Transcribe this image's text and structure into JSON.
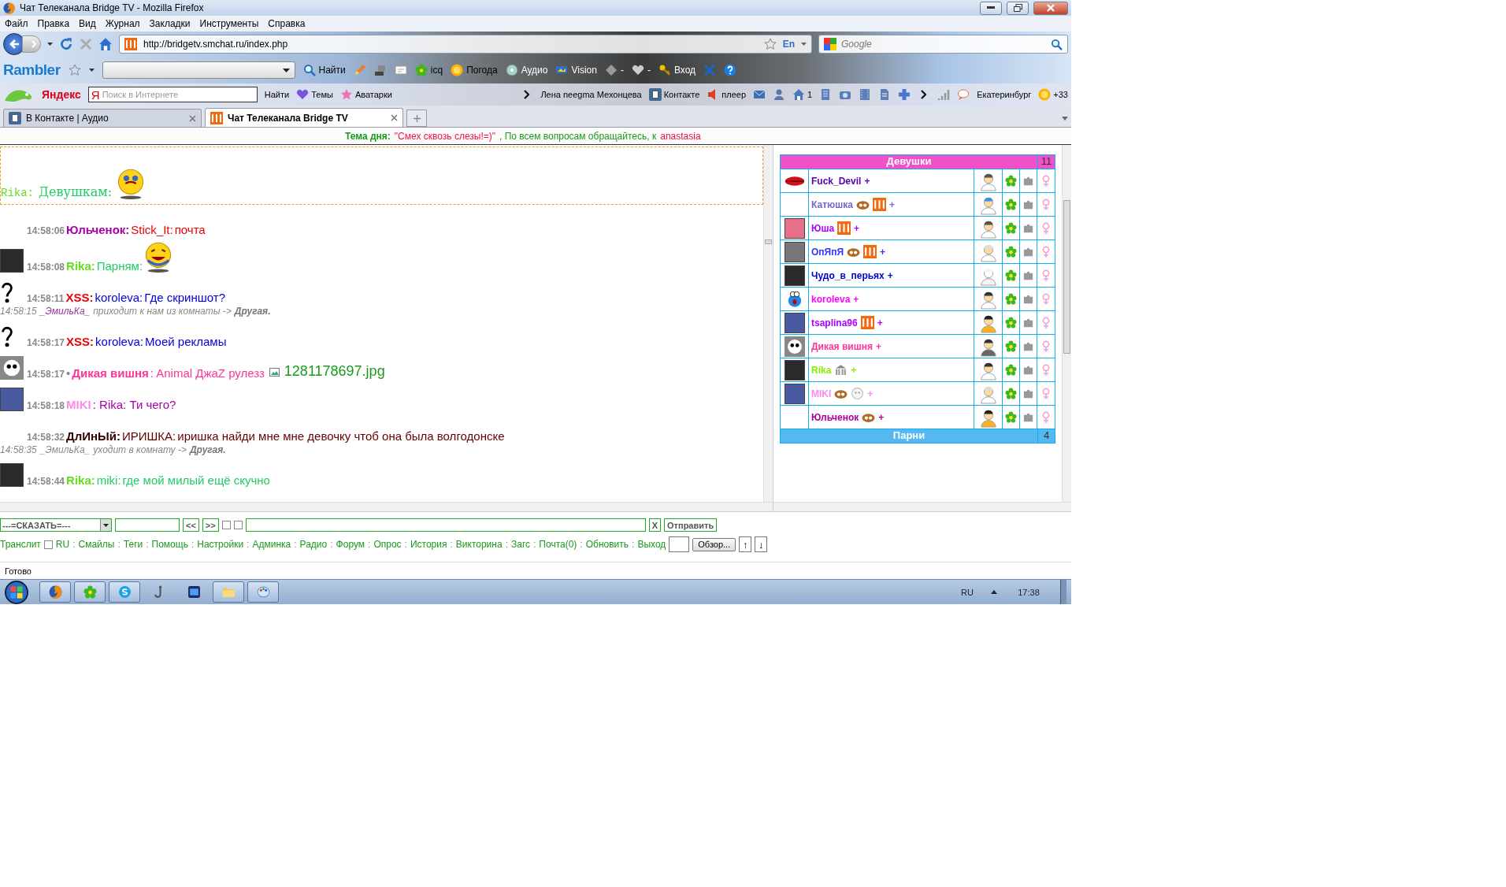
{
  "window": {
    "title": "Чат Телеканала Bridge TV - Mozilla Firefox"
  },
  "menu": [
    "Файл",
    "Правка",
    "Вид",
    "Журнал",
    "Закладки",
    "Инструменты",
    "Справка"
  ],
  "navigation": {
    "url": "http://bridgetv.smchat.ru/index.php",
    "language_badge": "En",
    "search_placeholder": "Google"
  },
  "rambler_toolbar": {
    "logo": "Rambler",
    "labels": [
      "Найти",
      "icq",
      "Погода",
      "Аудио",
      "Vision",
      "-",
      "-",
      "Вход"
    ]
  },
  "yandex_toolbar": {
    "logo": "Яндекс",
    "search_logo": "Я",
    "search_placeholder": "Поиск в Интернете",
    "search_button": "Найти",
    "left_labels": [
      "Темы",
      "Аватарки"
    ],
    "right_labels": [
      "Лена neegma Мехонцева",
      "Контакте",
      "плеер",
      "1",
      "Екатеринбург",
      "+33"
    ]
  },
  "tabs": [
    {
      "label": "В Контакте | Аудио",
      "selected": false
    },
    {
      "label": "Чат Телеканала Bridge TV",
      "selected": true
    }
  ],
  "topic": {
    "label": "Тема дня:",
    "text": "\"Смех сквозь слезы!=)\"",
    "note": ", По всем вопросам обращайтесь, к",
    "contact": "anastasia"
  },
  "messages": [
    {
      "kind": "boxed",
      "nick": "Rika:",
      "color": "#66dd22",
      "text": "Девушкам:"
    },
    {
      "kind": "message",
      "time": "14:58:06",
      "nick": "Юльченок:",
      "color": "#aa00aa",
      "to": "Stick_It:",
      "text": "почта"
    },
    {
      "kind": "message",
      "time": "14:58:08",
      "nick": "Rika:",
      "color": "#66dd22",
      "text": "Парням:"
    },
    {
      "kind": "message",
      "time": "14:58:11",
      "nick": "XSS:",
      "color": "#ee0000",
      "to": "koroleva:",
      "text": "Где скриншот?"
    },
    {
      "kind": "system",
      "time": "14:58:15",
      "nick": "_ЭмильКа_",
      "color": "#993399",
      "text": "приходит к нам из комнаты ->",
      "room": "Другая."
    },
    {
      "kind": "message",
      "time": "14:58:17",
      "nick": "XSS:",
      "color": "#ee0000",
      "to": "koroleva:",
      "text": "Моей рекламы"
    },
    {
      "kind": "message",
      "time": "14:58:17",
      "bullet": "•",
      "nick": "Дикая вишня",
      "color": "#ff3399",
      "text": ": Animal ДжаZ рулезз",
      "attachment": "1281178697.jpg"
    },
    {
      "kind": "message",
      "time": "14:58:18",
      "nick": "MIKI",
      "color": "#ff88ee",
      "text": ": Rika: Ти чего?"
    },
    {
      "kind": "message",
      "time": "14:58:32",
      "nick": "ДлИнЫй:",
      "color": "#330000",
      "to": "ИРИШКА:",
      "text": "иришка найди мне мне девочку чтоб она была волгодонске"
    },
    {
      "kind": "system",
      "time": "14:58:35",
      "nick": "_ЭмильКа_",
      "color": "#888888",
      "text": "уходит в комнату ->",
      "room": "Другая."
    },
    {
      "kind": "message",
      "time": "14:58:44",
      "nick": "Rika:",
      "color": "#66dd22",
      "to": "miki:",
      "text": "где мой милый ещё скучно"
    }
  ],
  "user_groups": [
    {
      "title": "Девушки",
      "count": "11",
      "color": "#f050c8",
      "users": [
        {
          "name": "Fuck_Devil",
          "plus": "+",
          "color": "#5500aa"
        },
        {
          "name": "Катюшка",
          "plus": "+",
          "color": "#7766cc"
        },
        {
          "name": "Юша",
          "plus": "+",
          "color": "#aa00ff"
        },
        {
          "name": "ОпЯпЯ",
          "plus": "+",
          "color": "#3333ff"
        },
        {
          "name": "Чудо_в_перьях",
          "plus": "+",
          "color": "#0000cc"
        },
        {
          "name": "koroleva",
          "plus": "+",
          "color": "#ff00ff"
        },
        {
          "name": "tsaplina96",
          "plus": "+",
          "color": "#aa00ff"
        },
        {
          "name": "Дикая вишня",
          "plus": "+",
          "color": "#ff3399"
        },
        {
          "name": "Rika",
          "plus": "+",
          "color": "#88ee00"
        },
        {
          "name": "MIKI",
          "plus": "+",
          "color": "#ff88ee"
        },
        {
          "name": "Юльченок",
          "plus": "+",
          "color": "#aa0099"
        }
      ]
    },
    {
      "title": "Парни",
      "count": "4",
      "color": "#55b8f0"
    }
  ],
  "composer": {
    "say_select": "---=СКАЗАТЬ=---",
    "prev": "<<",
    "next": ">>",
    "options": [
      {
        "checked": false
      },
      {
        "checked": false
      }
    ],
    "clear": "X",
    "send": "Отправить",
    "translit": "Транслит",
    "ru": {
      "label": "RU",
      "checked": false
    },
    "separator": ":",
    "links": [
      "Смайлы",
      "Теги",
      "Помощь",
      "Настройки",
      "Админка",
      "Радио",
      "Форум",
      "Опрос",
      "История",
      "Викторина",
      "Загс",
      "Почта(0)",
      "Обновить",
      "Выход"
    ],
    "browse": "Обзор...",
    "up": "↑",
    "down": "↓"
  },
  "status_bar": {
    "text": "Готово"
  },
  "taskbar": {
    "apps": [
      {
        "open": true
      },
      {
        "open": true
      },
      {
        "open": true
      },
      {
        "open": false
      },
      {
        "open": false
      },
      {
        "open": true
      },
      {
        "open": true
      }
    ],
    "language": "RU",
    "clock": "17:38"
  }
}
